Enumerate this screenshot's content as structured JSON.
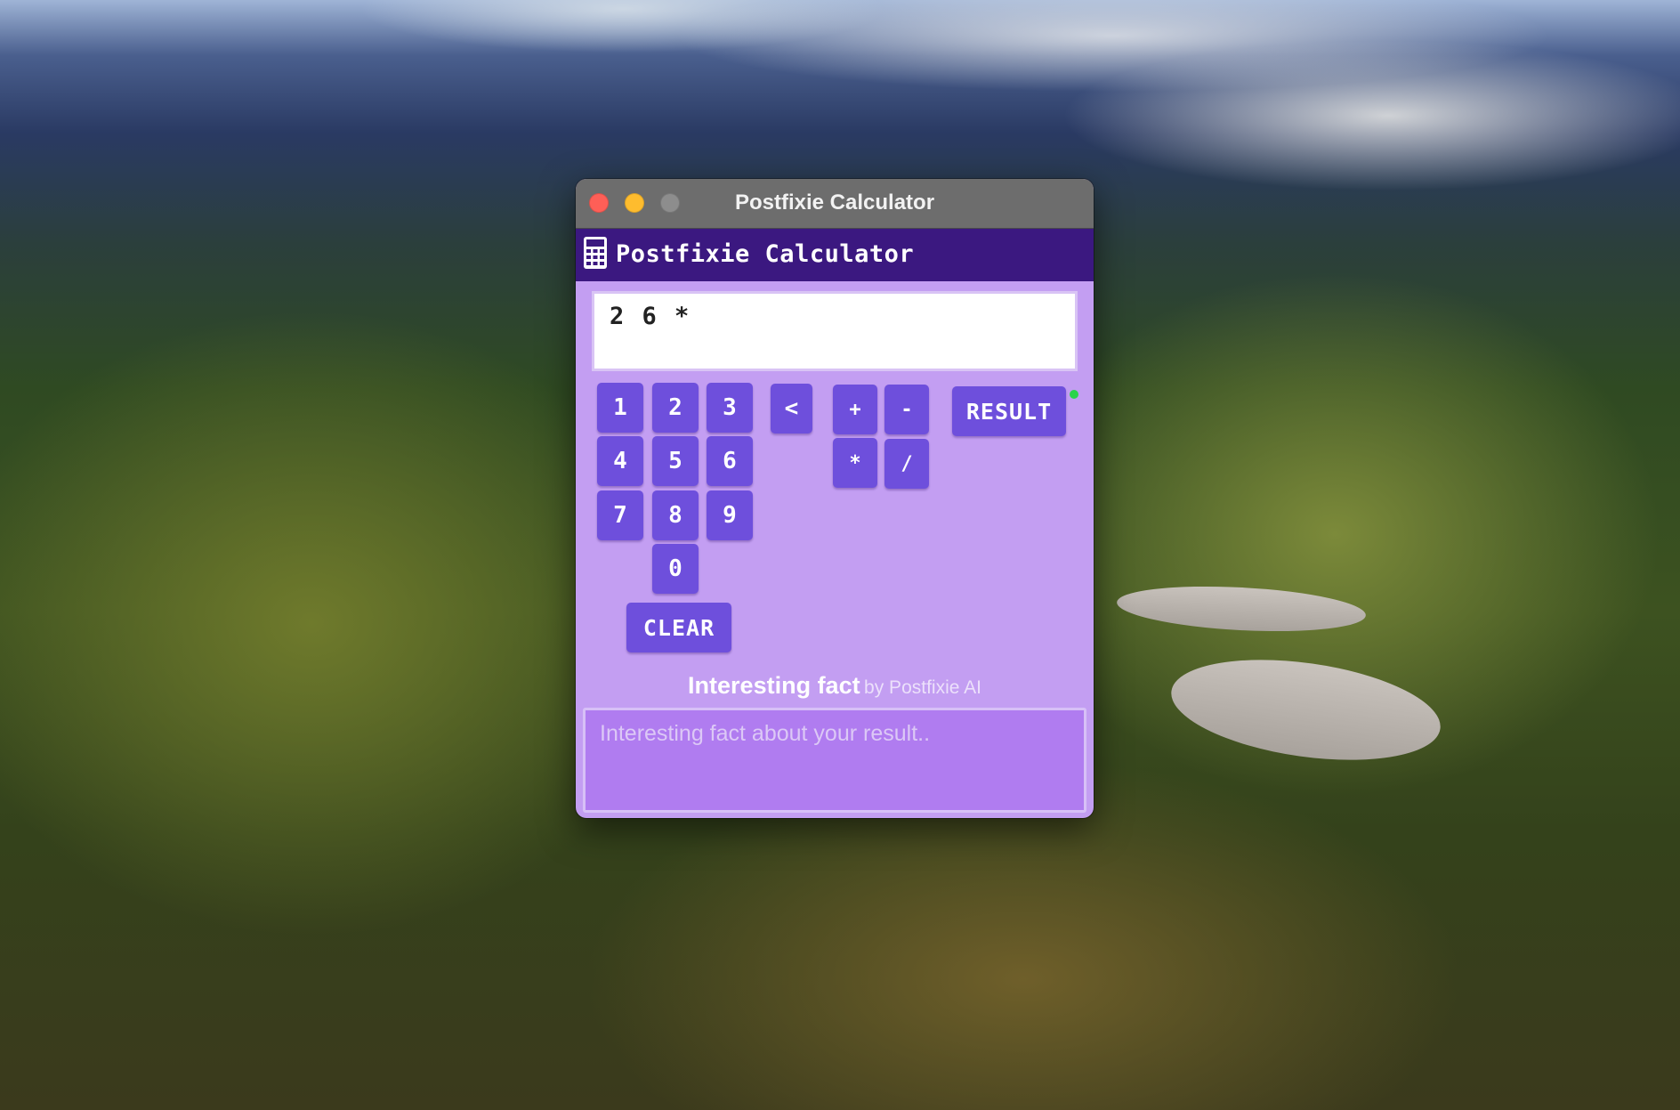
{
  "window": {
    "title": "Postfixie Calculator"
  },
  "app": {
    "title": "Postfixie Calculator",
    "icon": "calculator-icon"
  },
  "display": {
    "value": "2 6 *"
  },
  "keypad": {
    "digits": [
      "1",
      "2",
      "3",
      "4",
      "5",
      "6",
      "7",
      "8",
      "9",
      "0"
    ],
    "backspace": "<",
    "operators": [
      "+",
      "-",
      "*",
      "/"
    ],
    "result": "RESULT",
    "clear": "CLEAR"
  },
  "fact": {
    "title": "Interesting fact",
    "by": "by Postfixie AI",
    "placeholder": "Interesting fact about your result.."
  },
  "colors": {
    "header": "#3b1880",
    "body": "#c39ef2",
    "key": "#6e4fdc",
    "status": "#2bd44b"
  }
}
